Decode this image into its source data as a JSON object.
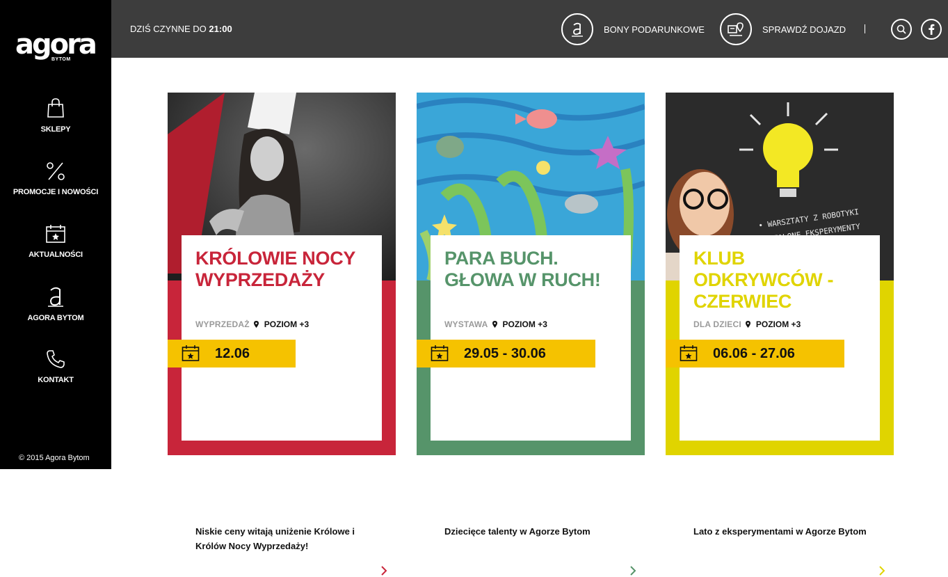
{
  "sidebar": {
    "logo_text": "agora",
    "logo_sub": "BYTOM",
    "items": [
      {
        "label": "SKLEPY",
        "icon": "shopping-bag-icon"
      },
      {
        "label": "PROMOCJE I NOWOŚCI",
        "icon": "percent-icon"
      },
      {
        "label": "AKTUALNOŚCI",
        "icon": "calendar-star-icon"
      },
      {
        "label": "AGORA BYTOM",
        "icon": "agora-a-icon"
      },
      {
        "label": "KONTAKT",
        "icon": "phone-icon"
      }
    ],
    "copyright": "© 2015 Agora Bytom"
  },
  "topbar": {
    "hours_prefix": "DZIŚ CZYNNE DO",
    "hours_time": "21:00",
    "gift_label": "BONY PODARUNKOWE",
    "directions_label": "SPRAWDŹ DOJAZD",
    "separator": "|"
  },
  "colors": {
    "red": "#c8253a",
    "green": "#56946a",
    "yellow": "#e0d400",
    "date_band": "#f5c200"
  },
  "cards": [
    {
      "title": "KRÓLOWIE NOCY WYPRZEDAŻY",
      "category": "WYPRZEDAŻ",
      "location": "POZIOM +3",
      "date": "12.06",
      "description": "Niskie ceny witają uniżenie Królowe i Królów Nocy Wyprzedaży!",
      "accent": "#c8253a"
    },
    {
      "title": "PARA BUCH. GŁOWA W RUCH!",
      "category": "WYSTAWA",
      "location": "POZIOM +3",
      "date": "29.05 - 30.06",
      "description": "Dziecięce talenty w Agorze Bytom",
      "accent": "#56946a"
    },
    {
      "title": "KLUB ODKRYWCÓW - CZERWIEC",
      "category": "DLA DZIECI",
      "location": "POZIOM +3",
      "date": "06.06 - 27.06",
      "description": "Lato z eksperymentami w Agorze Bytom",
      "accent": "#e0d400",
      "image_text": [
        "• WARSZTATY Z ROBOTYKI",
        "• SZALONE EKSPERYMENTY"
      ]
    }
  ]
}
